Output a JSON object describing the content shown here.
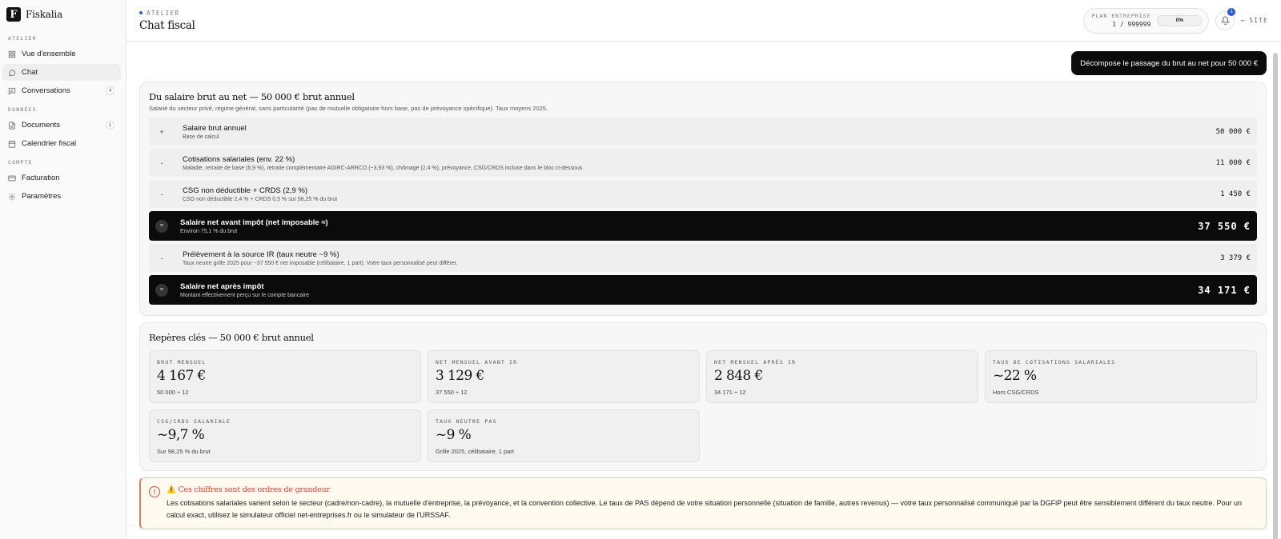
{
  "brand": {
    "name": "Fiskalia",
    "logo_letter": "F"
  },
  "sidebar": {
    "sections": [
      {
        "label": "ATELIER",
        "items": [
          {
            "label": "Vue d'ensemble",
            "icon": "grid-icon",
            "active": false,
            "badge": ""
          },
          {
            "label": "Chat",
            "icon": "chat-icon",
            "active": true,
            "badge": ""
          },
          {
            "label": "Conversations",
            "icon": "conversations-icon",
            "active": false,
            "badge": "4"
          }
        ]
      },
      {
        "label": "DONNÉES",
        "items": [
          {
            "label": "Documents",
            "icon": "document-icon",
            "active": false,
            "badge": "1"
          },
          {
            "label": "Calendrier fiscal",
            "icon": "calendar-icon",
            "active": false,
            "badge": ""
          }
        ]
      },
      {
        "label": "COMPTE",
        "items": [
          {
            "label": "Facturation",
            "icon": "card-icon",
            "active": false,
            "badge": ""
          },
          {
            "label": "Paramètres",
            "icon": "gear-icon",
            "active": false,
            "badge": ""
          }
        ]
      }
    ]
  },
  "header": {
    "crumb": "ATELIER",
    "title": "Chat fiscal",
    "plan_label": "PLAN ENTREPRISE",
    "plan_usage": "1 / 999999",
    "plan_percent": "0%",
    "notifications": "1",
    "site_link": "SITE"
  },
  "chat": {
    "user_message": "Décompose le passage du brut au net pour 50 000 €",
    "breakdown": {
      "title": "Du salaire brut au net — 50 000 € brut annuel",
      "subtitle": "Salarié du secteur privé, régime général, sans particularité (pas de mutuelle obligatoire hors base, pas de prévoyance spécifique). Taux moyens 2025.",
      "rows": [
        {
          "sign": "+",
          "label": "Salaire brut annuel",
          "desc": "Base de calcul",
          "amount": "50 000 €",
          "dark": false
        },
        {
          "sign": "-",
          "label": "Cotisations salariales (env. 22 %)",
          "desc": "Maladie, retraite de base (6,9 %), retraite complémentaire AGIRC-ARRCO (~3,93 %), chômage (2,4 %), prévoyance, CSG/CRDS incluse dans le bloc ci-dessous",
          "amount": "11 000 €",
          "dark": false
        },
        {
          "sign": "-",
          "label": "CSG non déductible + CRDS (2,9 %)",
          "desc": "CSG non déductible 2,4 % + CRDS 0,5 % sur 98,25 % du brut",
          "amount": "1 450 €",
          "dark": false
        },
        {
          "sign": "=",
          "label": "Salaire net avant impôt (net imposable ≈)",
          "desc": "Environ 75,1 % du brut",
          "amount": "37 550 €",
          "dark": true
        },
        {
          "sign": "-",
          "label": "Prélèvement à la source IR (taux neutre ~9 %)",
          "desc": "Taux neutre grille 2025 pour ~37 550 € net imposable (célibataire, 1 part). Votre taux personnalisé peut différer.",
          "amount": "3 379 €",
          "dark": false
        },
        {
          "sign": "=",
          "label": "Salaire net après impôt",
          "desc": "Montant effectivement perçu sur le compte bancaire",
          "amount": "34 171 €",
          "dark": true
        }
      ]
    },
    "kpis": {
      "title": "Repères clés — 50 000 € brut annuel",
      "items": [
        {
          "label": "BRUT MENSUEL",
          "value": "4 167 €",
          "sub": "50 000 ÷ 12"
        },
        {
          "label": "NET MENSUEL AVANT IR",
          "value": "3 129 €",
          "sub": "37 550 ÷ 12"
        },
        {
          "label": "NET MENSUEL APRÈS IR",
          "value": "2 848 €",
          "sub": "34 171 ÷ 12"
        },
        {
          "label": "TAUX DE COTISATIONS SALARIALES",
          "value": "~22 %",
          "sub": "Hors CSG/CRDS"
        },
        {
          "label": "CSG/CRDS SALARIALE",
          "value": "~9,7 %",
          "sub": "Sur 98,25 % du brut"
        },
        {
          "label": "TAUX NEUTRE PAS",
          "value": "~9 %",
          "sub": "Grille 2025, célibataire, 1 part"
        }
      ]
    },
    "warning": {
      "title": "⚠️ Ces chiffres sont des ordres de grandeur",
      "text": "Les cotisations salariales varient selon le secteur (cadre/non-cadre), la mutuelle d'entreprise, la prévoyance, et la convention collective. Le taux de PAS dépend de votre situation personnelle (situation de famille, autres revenus) — votre taux personnalisé communiqué par la DGFiP peut être sensiblement différent du taux neutre. Pour un calcul exact, utilisez le simulateur officiel net-entreprises.fr ou le simulateur de l'URSSAF."
    }
  }
}
